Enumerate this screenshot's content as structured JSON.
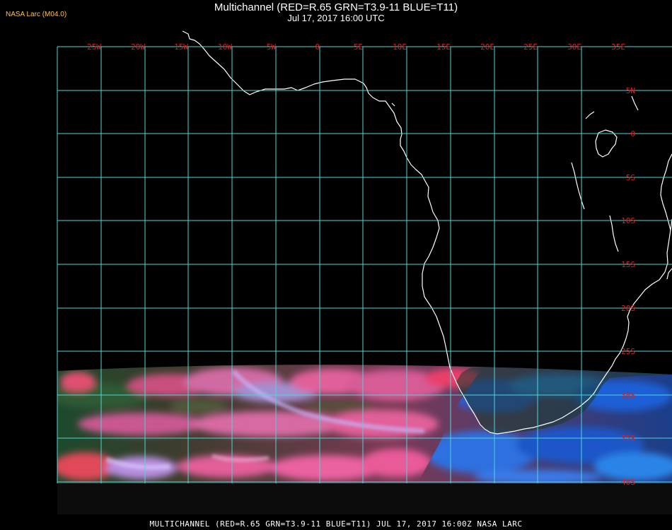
{
  "header": {
    "title": "Multichannel (RED=R.65 GRN=T3.9-11 BLUE=T11)",
    "subtitle": "Jul 17, 2017 16:00 UTC",
    "agency": "NASA Larc (M04.0)"
  },
  "footer": {
    "caption": "MULTICHANNEL (RED=R.65 GRN=T3.9-11 BLUE=T11) JUL 17, 2017 16:00Z    NASA LARC"
  },
  "map": {
    "lon_labels": [
      "25W",
      "20W",
      "15W",
      "10W",
      "5W",
      "0",
      "5E",
      "10E",
      "15E",
      "20E",
      "25E",
      "30E",
      "35E"
    ],
    "lat_labels": [
      "5N",
      "0",
      "5S",
      "10S",
      "15S",
      "20S",
      "25S",
      "30S",
      "35S",
      "40S"
    ],
    "colors": {
      "grid": "#4fd6d6",
      "label": "#d42222",
      "coast": "#ffffff",
      "background": "#000000"
    }
  }
}
